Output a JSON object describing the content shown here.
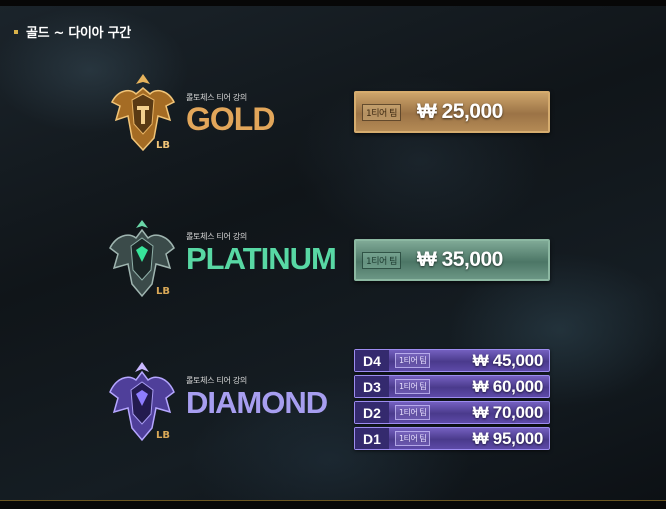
{
  "heading": "골드 ~ 다이아 구간",
  "tiers": [
    {
      "subtitle": "롤토체스 티어 강의",
      "name": "GOLD",
      "color": "#e2a65a",
      "price": {
        "badge": "1티어 팀",
        "amount": "₩ 25,000"
      }
    },
    {
      "subtitle": "롤토체스 티어 강의",
      "name": "PLATINUM",
      "color": "#58d8a4",
      "price": {
        "badge": "1티어 팀",
        "amount": "₩ 35,000"
      }
    },
    {
      "subtitle": "롤토체스 티어 강의",
      "name": "DIAMOND",
      "color": "#a79ef0",
      "prices": [
        {
          "division": "D4",
          "badge": "1티어 팀",
          "amount": "₩ 45,000"
        },
        {
          "division": "D3",
          "badge": "1티어 팀",
          "amount": "₩ 60,000"
        },
        {
          "division": "D2",
          "badge": "1티어 팀",
          "amount": "₩ 70,000"
        },
        {
          "division": "D1",
          "badge": "1티어 팀",
          "amount": "₩ 95,000"
        }
      ]
    }
  ],
  "emblem_mark": "LB",
  "icons": [
    "gold-rank-emblem-icon",
    "platinum-rank-emblem-icon",
    "diamond-rank-emblem-icon"
  ]
}
